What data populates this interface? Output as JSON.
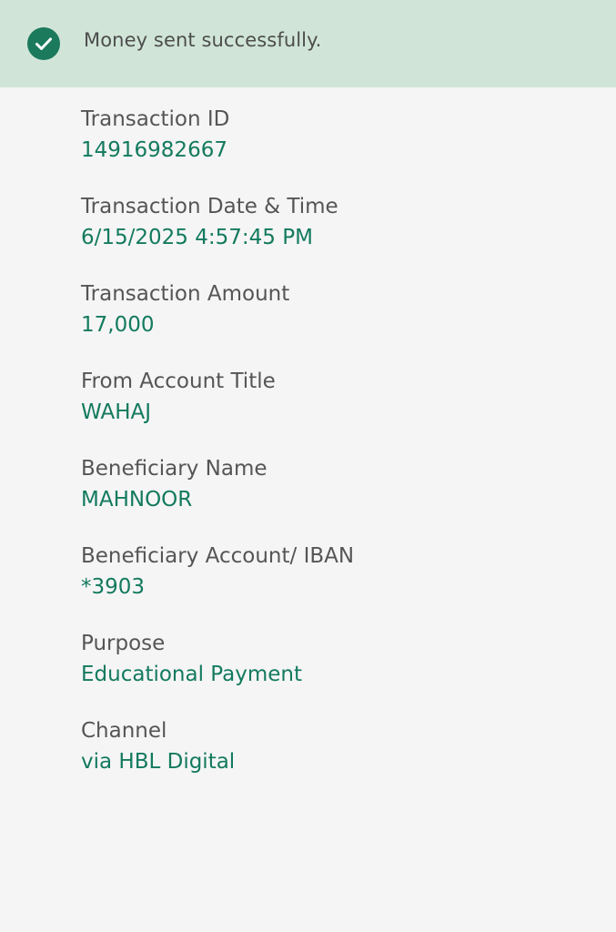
{
  "status": {
    "message": "Money sent successfully.",
    "icon": "check-circle-icon",
    "accent_color": "#1b7a5b",
    "banner_color": "#d0e5d8"
  },
  "details": [
    {
      "label": "Transaction ID",
      "value": "14916982667"
    },
    {
      "label": "Transaction Date & Time",
      "value": "6/15/2025 4:57:45 PM"
    },
    {
      "label": "Transaction Amount",
      "value": "17,000"
    },
    {
      "label": "From Account Title",
      "value": "WAHAJ"
    },
    {
      "label": "Beneficiary Name",
      "value": "MAHNOOR"
    },
    {
      "label": "Beneficiary Account/ IBAN",
      "value": "*3903"
    },
    {
      "label": "Purpose",
      "value": "Educational Payment"
    },
    {
      "label": "Channel",
      "value": "via HBL Digital"
    }
  ]
}
